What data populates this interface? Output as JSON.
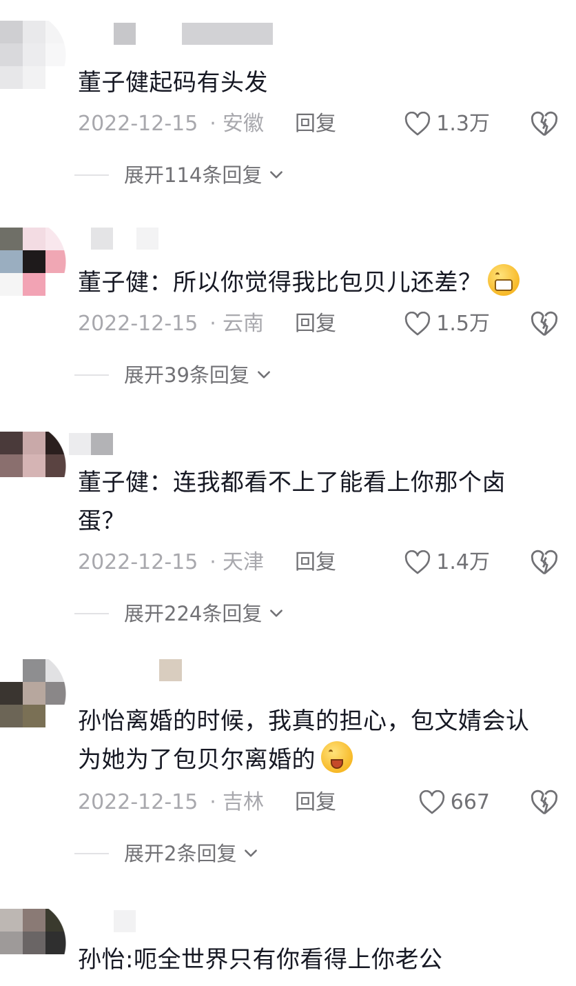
{
  "comments": [
    {
      "avatar_colors": [
        "#cfcfd2",
        "#e9e9eb",
        "#f4f4f5",
        "#d9d9dc",
        "#ececee",
        "#f7f7f8",
        "#e7e7e9",
        "#f2f2f3",
        "#ffffff"
      ],
      "name_blocks": [
        "#c7c7ca",
        "#d2d2d5"
      ],
      "text": "董子健起码有头发",
      "date": "2022-12-15",
      "region": "安徽",
      "reply": "回复",
      "likes": "1.3万",
      "expand": "展开114条回复"
    },
    {
      "avatar_colors": [
        "#6f6f67",
        "#f3dce3",
        "#f9e7ed",
        "#9aaec0",
        "#1e1a1b",
        "#f0a7b4",
        "#f5f5f5",
        "#f2a3b4",
        "#ffffff"
      ],
      "name_blocks": [
        "#e4e4e6",
        "#f3f3f4"
      ],
      "text": "董子健：所以你觉得我比包贝儿还差？",
      "emoji": "grimace-sweat-emoji",
      "date": "2022-12-15",
      "region": "云南",
      "reply": "回复",
      "likes": "1.5万",
      "expand": "展开39条回复"
    },
    {
      "avatar_colors": [
        "#4a3a3a",
        "#c9a9a9",
        "#2a1f1e",
        "#8a6f6e",
        "#d5b4b4",
        "#5a4341",
        "#ffffff",
        "#ffffff",
        "#ffffff"
      ],
      "name_blocks": [
        "#ececee",
        "#b3b3b6"
      ],
      "text_lines": [
        "董子健：连我都看不上了能看上你那个卤",
        "蛋？"
      ],
      "date": "2022-12-15",
      "region": "天津",
      "reply": "回复",
      "likes": "1.4万",
      "expand": "展开224条回复"
    },
    {
      "avatar_colors": [
        "#ffffff",
        "#8e8e90",
        "#e1e1e3",
        "#3a3530",
        "#b7a79e",
        "#8a8788",
        "#6c6556",
        "#7a7055",
        "#ffffff"
      ],
      "name_blocks": [
        "#d9cdbf"
      ],
      "text_lines": [
        "孙怡离婚的时候，我真的担心，包文婧会认",
        "为她为了包贝尔离婚的"
      ],
      "emoji": "crying-emoji",
      "date": "2022-12-15",
      "region": "吉林",
      "reply": "回复",
      "likes": "667",
      "expand": "展开2条回复"
    },
    {
      "avatar_colors": [
        "#bdb7b3",
        "#8a7a75",
        "#3a3a2e",
        "#9e9a99",
        "#6a6565",
        "#2f2f2f",
        "#ffffff",
        "#ffffff",
        "#ffffff"
      ],
      "name_blocks": [
        "#f2f2f3"
      ],
      "text": "孙怡:呃全世界只有你看得上你老公"
    }
  ]
}
